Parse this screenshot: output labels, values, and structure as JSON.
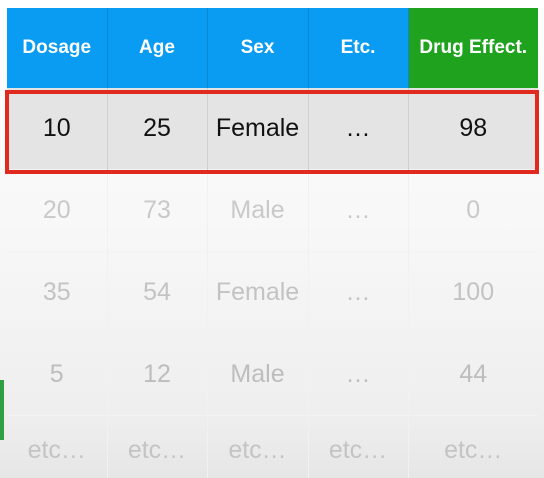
{
  "table": {
    "headers": [
      "Dosage",
      "Age",
      "Sex",
      "Etc.",
      "Drug Effect."
    ],
    "rows": [
      [
        "10",
        "25",
        "Female",
        "…",
        "98"
      ],
      [
        "20",
        "73",
        "Male",
        "…",
        "0"
      ],
      [
        "35",
        "54",
        "Female",
        "…",
        "100"
      ],
      [
        "5",
        "12",
        "Male",
        "…",
        "44"
      ],
      [
        "etc…",
        "etc…",
        "etc…",
        "etc…",
        "etc…"
      ]
    ],
    "highlighted_row": 0
  },
  "colors": {
    "header_blue": "#0a9bf2",
    "header_green": "#1fa31f",
    "highlight_border": "#e02a20",
    "highlight_fill": "#e4e4e4",
    "faded_text": "#c9c9c9"
  }
}
